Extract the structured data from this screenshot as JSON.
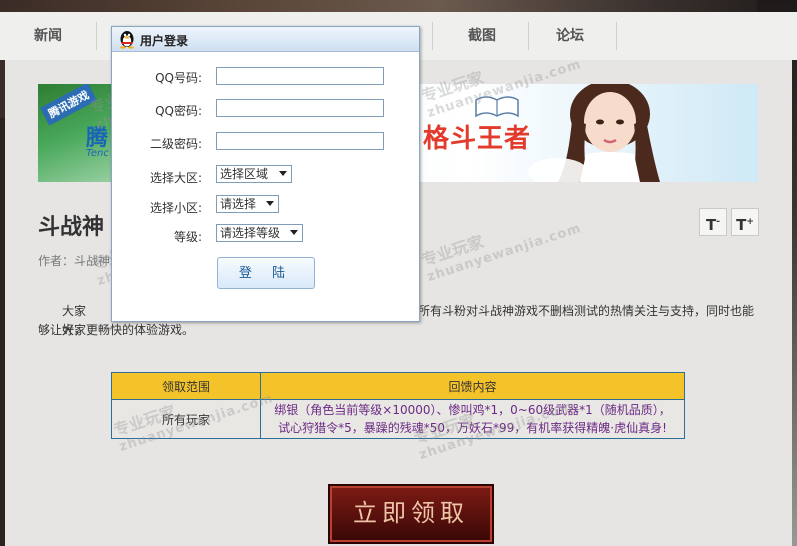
{
  "nav": {
    "items": [
      "新闻",
      "截图",
      "论坛"
    ]
  },
  "dialog": {
    "title": "用户登录",
    "fields": [
      {
        "label": "QQ号码:",
        "value": ""
      },
      {
        "label": "QQ密码:",
        "value": ""
      },
      {
        "label": "二级密码:",
        "value": ""
      }
    ],
    "selects": [
      {
        "label": "选择大区:",
        "value": "选择区域"
      },
      {
        "label": "选择小区:",
        "value": "请选择"
      },
      {
        "label": "等级:",
        "value": "请选择等级"
      }
    ],
    "login_label": "登 陆"
  },
  "banner": {
    "tag": "腾讯游戏",
    "logo": "腾",
    "logo_sub": "Tenc",
    "slogan": "格斗王者"
  },
  "article": {
    "title": "斗战神",
    "author": "作者：斗战神",
    "para_start": "大家好，",
    "para_mid": "所有斗粉对斗战神游戏不删档测试的热情关注与支持，同时也能",
    "para_end": "够让大家更畅快的体验游戏。"
  },
  "font_controls": {
    "decrease": "T",
    "decrease_sup": "-",
    "increase": "T",
    "increase_sup": "+"
  },
  "gift_table": {
    "headers": [
      "领取范围",
      "回馈内容"
    ],
    "rows": [
      {
        "scope": "所有玩家",
        "content_line1": "绑银（角色当前等级×10000）、惨叫鸡*1，0~60级武器*1（随机品质），",
        "content_line2": "试心狩猎令*5，暴躁的残魂*50，万妖石*99，有机率获得精魄·虎仙真身!"
      }
    ]
  },
  "claim_button": "立即领取",
  "watermark": {
    "cn": "专业玩家",
    "en": "zhuanyewanjia.com"
  },
  "colors": {
    "table_header": "#f4c32a",
    "table_border": "#2d6e97",
    "content_text": "#6c2a86",
    "claim_bg": "#5a100c"
  }
}
